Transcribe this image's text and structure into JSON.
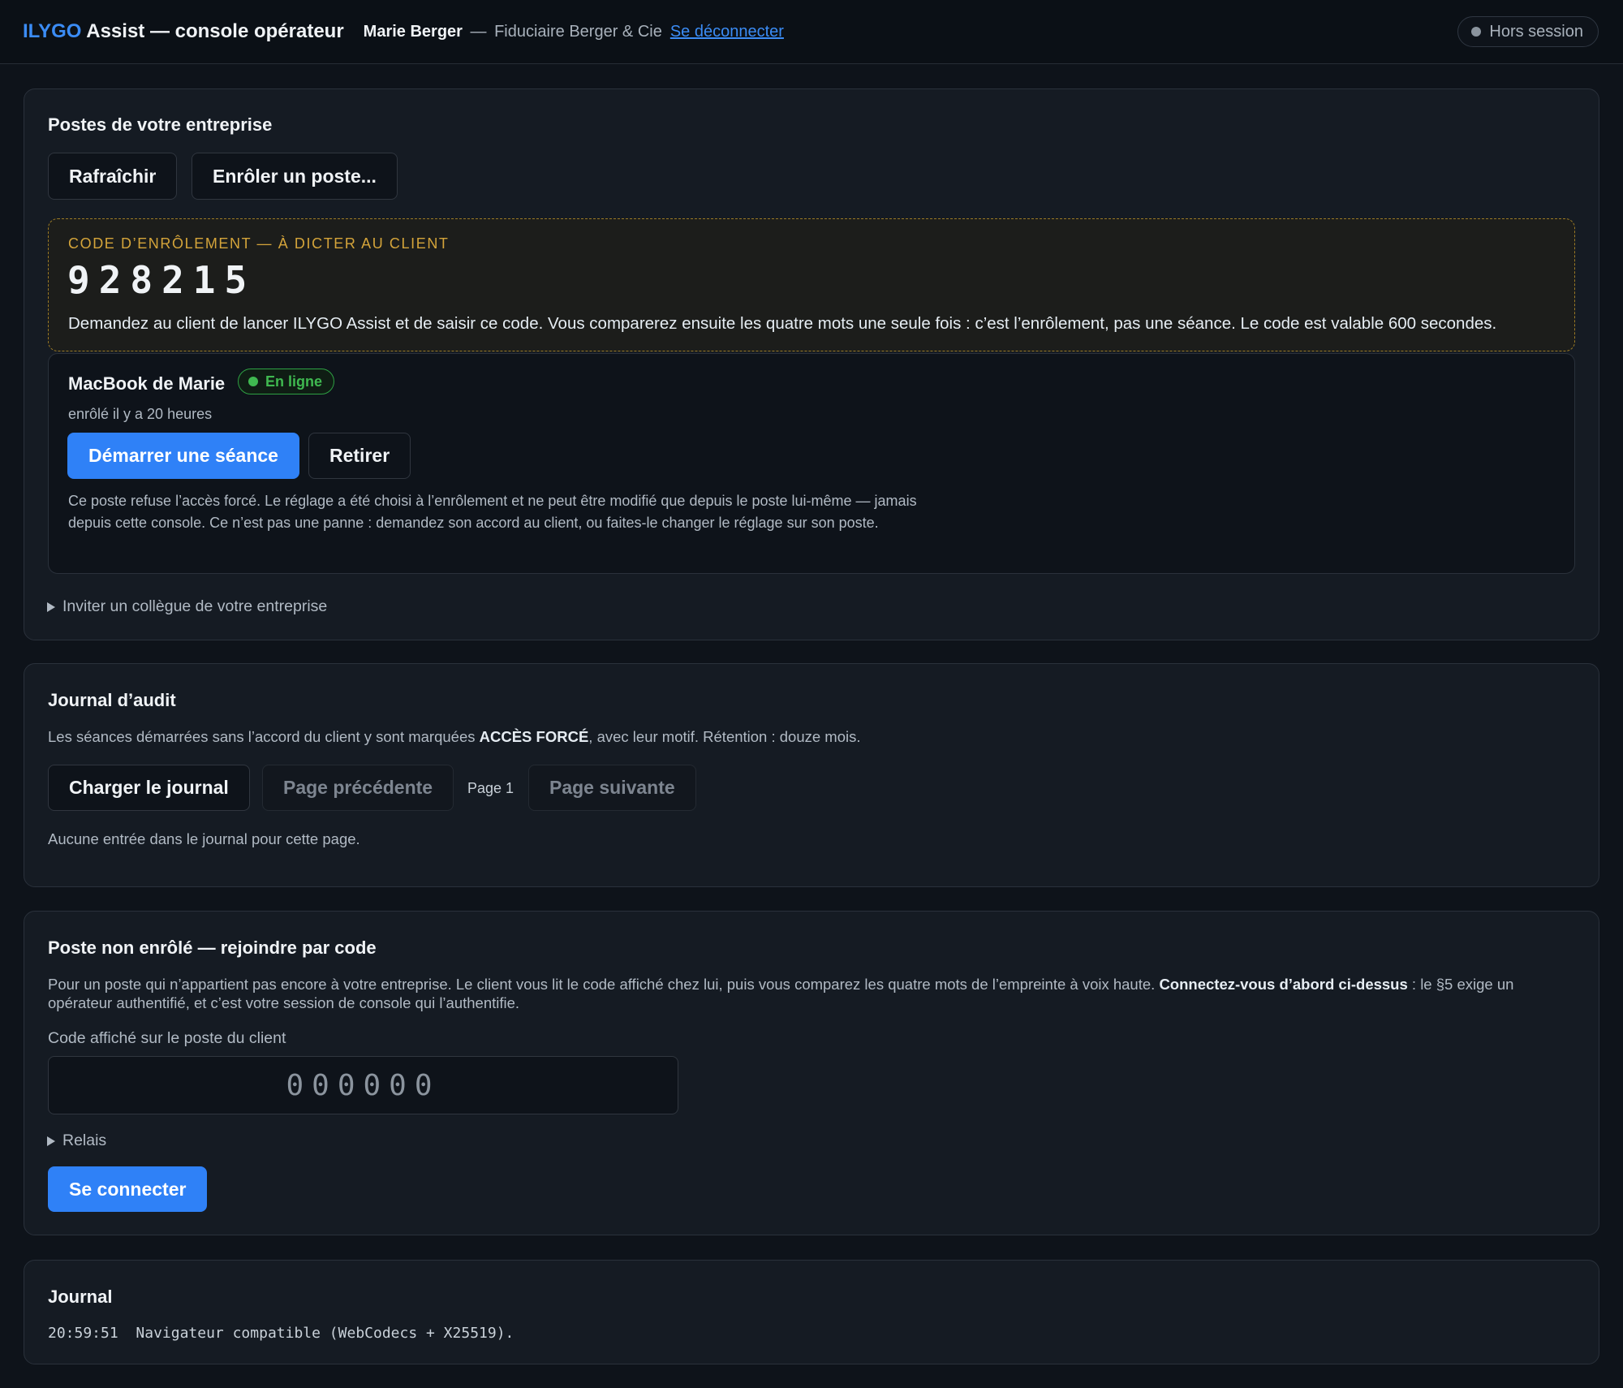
{
  "header": {
    "brand_accent": "ILYGO",
    "brand_rest": " Assist — console opérateur",
    "operator_name": "Marie Berger",
    "separator": "—",
    "company": "Fiduciaire Berger & Cie",
    "logout_label": "Se déconnecter",
    "session_status": "Hors session"
  },
  "devices_panel": {
    "title": "Postes de votre entreprise",
    "refresh_label": "Rafraîchir",
    "enroll_label": "Enrôler un poste...",
    "enrollment": {
      "label": "CODE D’ENRÔLEMENT — À DICTER AU CLIENT",
      "code": "928215",
      "description": "Demandez au client de lancer ILYGO Assist et de saisir ce code. Vous comparerez ensuite les quatre mots une seule fois : c’est l’enrôlement, pas une séance. Le code est valable 600 secondes."
    },
    "device": {
      "name": "MacBook de Marie",
      "status": "En ligne",
      "enrolled": "enrôlé il y a 20 heures",
      "start_label": "Démarrer une séance",
      "remove_label": "Retirer",
      "note": "Ce poste refuse l’accès forcé. Le réglage a été choisi à l’enrôlement et ne peut être modifié que depuis le poste lui-même — jamais depuis cette console. Ce n’est pas une panne : demandez son accord au client, ou faites-le changer le réglage sur son poste."
    },
    "invite_label": "Inviter un collègue de votre entreprise"
  },
  "audit_panel": {
    "title": "Journal d’audit",
    "desc_before": "Les séances démarrées sans l’accord du client y sont marquées ",
    "desc_bold": "ACCÈS FORCÉ",
    "desc_after": ", avec leur motif. Rétention : douze mois.",
    "load_label": "Charger le journal",
    "prev_label": "Page précédente",
    "page_label": "Page 1",
    "next_label": "Page suivante",
    "empty_message": "Aucune entrée dans le journal pour cette page."
  },
  "join_panel": {
    "title": "Poste non enrôlé — rejoindre par code",
    "desc_before": "Pour un poste qui n’appartient pas encore à votre entreprise. Le client vous lit le code affiché chez lui, puis vous comparez les quatre mots de l’empreinte à voix haute. ",
    "desc_bold": "Connectez-vous d’abord ci-dessus",
    "desc_after": " : le §5 exige un opérateur authentifié, et c’est votre session de console qui l’authentifie.",
    "field_label": "Code affiché sur le poste du client",
    "code_value": "",
    "code_placeholder": "000000",
    "relay_label": "Relais",
    "connect_label": "Se connecter"
  },
  "log_panel": {
    "title": "Journal",
    "lines": [
      {
        "time": "20:59:51",
        "message": "Navigateur compatible (WebCodecs + X25519)."
      }
    ]
  },
  "colors": {
    "accent": "#2f81f7",
    "online": "#3fb950",
    "warning": "#d4a43a",
    "background": "#0e131a",
    "panel": "#151b23"
  }
}
